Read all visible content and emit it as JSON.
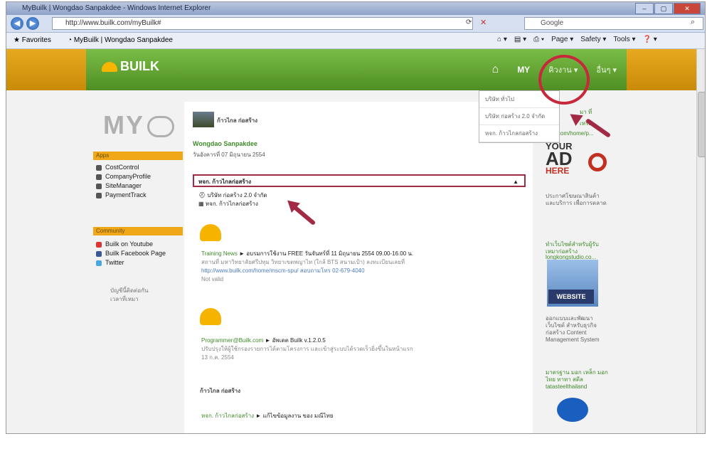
{
  "window": {
    "title": "MyBuilk | Wongdao Sanpakdee - Windows Internet Explorer",
    "url": "http://www.builk.com/myBuilk#",
    "search_placeholder": "Google",
    "favorites_label": "Favorites",
    "tab_label": "MyBuilk | Wongdao Sanpakdee",
    "commands": [
      "Page ▾",
      "Safety ▾",
      "Tools ▾"
    ]
  },
  "site": {
    "logo": "BUILK",
    "nav": {
      "my": "MY",
      "item1": "คิวงาน ▾",
      "item2": "อื่นๆ ▾"
    },
    "dropdown": [
      "บริษัท ทั่วไป",
      "บริษัท ก่อสร้าง 2.0 จำกัด",
      "หจก. ก้าวไกลก่อสร้าง"
    ]
  },
  "sidebar": {
    "my_logo": "MY",
    "apps_title": "Apps",
    "apps": [
      "CostControl",
      "CompanyProfile",
      "SiteManager",
      "PaymentTrack"
    ],
    "community_title": "Community",
    "community": [
      "Builk on Youtube",
      "Builk Facebook Page",
      "Twitter"
    ],
    "note_line1": "บัญชีนี้ติดต่อกัน",
    "note_line2": "เวลาที่เหมา"
  },
  "main": {
    "logo_small": "ก้าวไกล ก่อสร้าง",
    "user_name": "Wongdao Sanpakdee",
    "user_date": "วันอังคารที่ 07 มิถุนายน 2554",
    "select_value": "หจก. ก้าวไกลก่อสร้าง",
    "options": [
      "บริษัท ก่อสร้าง 2.0 จำกัด",
      "หจก. ก้าวไกลก่อสร้าง"
    ],
    "posts": [
      {
        "source": "Training News",
        "title": "► อบรมการใช้งาน FREE วันจันทร์ที่ 11 มิถุนายน 2554 09.00-16.00 น.",
        "line2": "สถานที่ มหาวิทยาลัยศรีปทุม วิทยาเขตพญาไท (ใกล้ BTS สนามเป้า) ลงทะเบียนเลยที่",
        "link": "http://www.builk.com/home/mscm-spu/ สอบถามโทร 02-679-4040",
        "meta": "Not valid"
      },
      {
        "source": "Programmer@Builk.com",
        "title": "► อัพเดต Builk v.1.2.0.5",
        "line2": "ปรับปรุงให้ผู้ใช้กรองรายการได้ตามโครงการ และเข้าสู่ระบบได้รวดเร็วยิ่งขึ้นในหน้าแรก",
        "link": "",
        "meta": "13 ก.ค. 2554"
      },
      {
        "source": "หจก. ก้าวไกลก่อสร้าง",
        "title": "► แก้ไขข้อมูลงาน ของ มณีไทย",
        "line2": "",
        "link": "",
        "meta": ""
      }
    ]
  },
  "rightcol": {
    "top_line1": "มา ที่",
    "top_line2": "เหรือ",
    "top_link": "bulk.com/home/p...",
    "ad_your": "YOUR",
    "ad_ad": "AD",
    "ad_here": "HERE",
    "ad_desc": "ประกาศโฆษณาสินค้าและบริการ เพื่อการตลาด",
    "link2_title": "ทำเว็บไซต์สำหรับผู้รับเหมาก่อสร้าง",
    "link2_url": "longkongstudio.co...",
    "website_badge": "WEBSITE",
    "desc3": "ออกแบบและพัฒนาเว็บไซต์ สำหรับธุรกิจก่อสร้าง Content Management System",
    "link4_title": "มาตรฐาน มอก เหล็ก มอก ไทย ทาทา สตีล",
    "link4_url": "tatasteelthailand"
  }
}
